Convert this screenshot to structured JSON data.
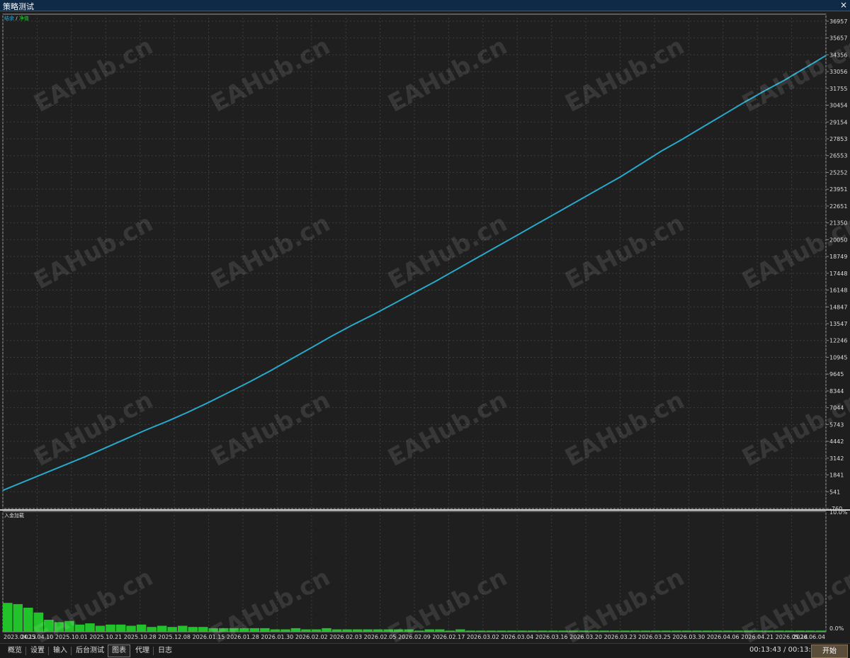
{
  "window": {
    "title": "策略测试",
    "close_glyph": "×"
  },
  "chart_data": [
    {
      "type": "line",
      "legend": {
        "label_a": "结余",
        "sep": "/",
        "label_b": "净值",
        "placement": "top-left"
      },
      "x_ticks": [
        "2023.04.13",
        "2025.04.10",
        "2025.10.01",
        "2025.10.21",
        "2025.10.28",
        "2025.12.08",
        "2026.01.15",
        "2026.01.28",
        "2026.01.30",
        "2026.02.02",
        "2026.02.03",
        "2026.02.05",
        "2026.02.09",
        "2026.02.17",
        "2026.03.02",
        "2026.03.04",
        "2026.03.16",
        "2026.03.20",
        "2026.03.23",
        "2026.03.25",
        "2026.03.30",
        "2026.04.06",
        "2026.04.21",
        "2026.05.14",
        "2026.06.04"
      ],
      "y_ticks": [
        36957,
        35657,
        34356,
        33056,
        31755,
        30454,
        29154,
        27853,
        26553,
        25252,
        23951,
        22651,
        21350,
        20050,
        18749,
        17448,
        16148,
        14847,
        13547,
        12246,
        10945,
        9645,
        8344,
        7044,
        5743,
        4442,
        3142,
        1841,
        541,
        -760
      ],
      "ylim": [
        -760,
        37500
      ],
      "grid": true,
      "series": [
        {
          "key": "balance",
          "color": "#1f9fc8",
          "values": [
            650,
            1300,
            1950,
            2600,
            3250,
            3950,
            4650,
            5350,
            6000,
            6700,
            7450,
            8250,
            9050,
            9900,
            10800,
            11700,
            12600,
            13450,
            14250,
            15100,
            15950,
            16800,
            17700,
            18600,
            19500,
            20400,
            21300,
            22200,
            23100,
            24000,
            24900,
            25900,
            26900,
            27800,
            28750,
            29700,
            30650,
            31550,
            32400,
            33350,
            34300
          ]
        },
        {
          "key": "equity",
          "color": "#2fb0cc",
          "values": [
            650,
            1290,
            1960,
            2590,
            3260,
            3940,
            4660,
            5340,
            6010,
            6690,
            7460,
            8240,
            9060,
            9890,
            10810,
            11690,
            12610,
            13440,
            14260,
            15090,
            15960,
            16790,
            17710,
            18590,
            19510,
            20390,
            21310,
            22190,
            23110,
            23990,
            24910,
            25890,
            26910,
            27790,
            28760,
            29690,
            30660,
            31540,
            32410,
            33340,
            34310
          ]
        }
      ]
    },
    {
      "type": "bar",
      "title": "入金加载",
      "y_ticks": [
        "10.0%",
        "0.0%"
      ],
      "ylim": [
        0,
        10
      ],
      "color": "#22c22a",
      "values": [
        2.4,
        2.3,
        2.0,
        1.6,
        1.0,
        0.8,
        0.9,
        0.6,
        0.7,
        0.5,
        0.6,
        0.6,
        0.5,
        0.6,
        0.4,
        0.5,
        0.4,
        0.5,
        0.4,
        0.4,
        0.3,
        0.3,
        0.3,
        0.3,
        0.3,
        0.3,
        0.2,
        0.2,
        0.3,
        0.2,
        0.2,
        0.3,
        0.2,
        0.2,
        0.2,
        0.2,
        0.2,
        0.2,
        0.2,
        0.2,
        0.1,
        0.2,
        0.2,
        0.1,
        0.2,
        0.1,
        0.1,
        0.1,
        0.1,
        0.1,
        0.1,
        0.1,
        0.1,
        0.1,
        0.1,
        0.1,
        0.1,
        0.1,
        0.1,
        0.1,
        0.1,
        0.1,
        0.1,
        0.1,
        0.1,
        0.1,
        0.1,
        0.1,
        0.1,
        0.1,
        0.1,
        0.1,
        0.1,
        0.1,
        0.1,
        0.1,
        0.1,
        0.1,
        0.1,
        0.1
      ]
    }
  ],
  "watermark_text": "EAHub.cn",
  "tabs": [
    "概览",
    "设置",
    "输入",
    "后台测试",
    "图表",
    "代理",
    "日志"
  ],
  "active_tab": 4,
  "status": {
    "clock": "00:13:43 / 00:13:43",
    "start_label": "开始"
  }
}
